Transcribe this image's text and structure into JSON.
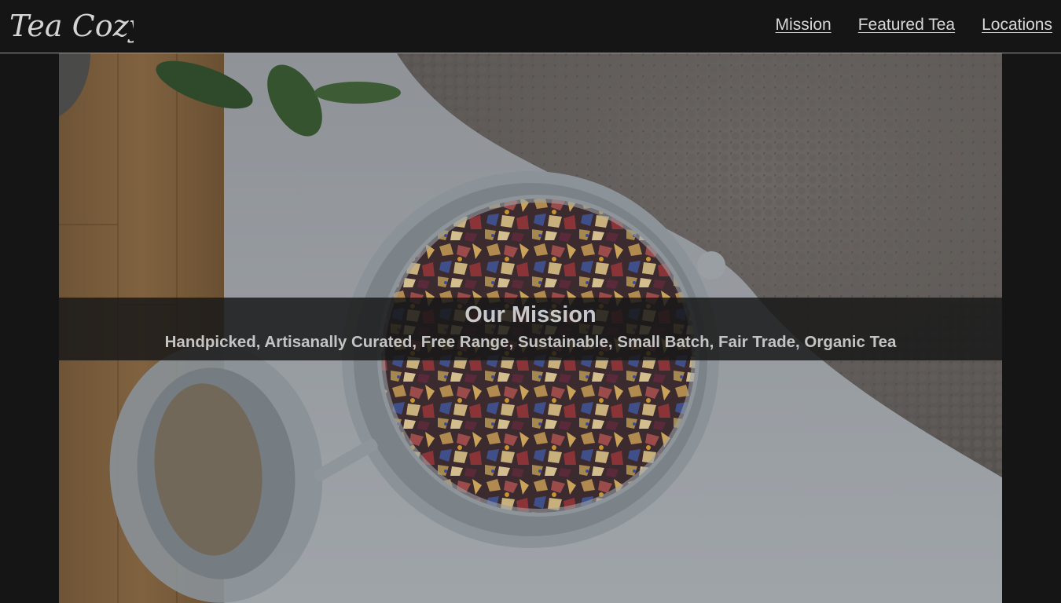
{
  "brand": {
    "logo_text": "Tea Cozy"
  },
  "nav": {
    "items": [
      {
        "label": "Mission"
      },
      {
        "label": "Featured Tea"
      },
      {
        "label": "Locations"
      }
    ]
  },
  "hero": {
    "image_subject": "open glass jar of loose-leaf herbal tea on a white table next to a wooden board and knit fabric",
    "title": "Our Mission",
    "subtitle": "Handpicked, Artisanally Curated, Free Range, Sustainable, Small Batch, Fair Trade, Organic Tea"
  },
  "colors": {
    "background": "#151515",
    "nav_text": "#d8d8d8",
    "band": "#181818"
  }
}
